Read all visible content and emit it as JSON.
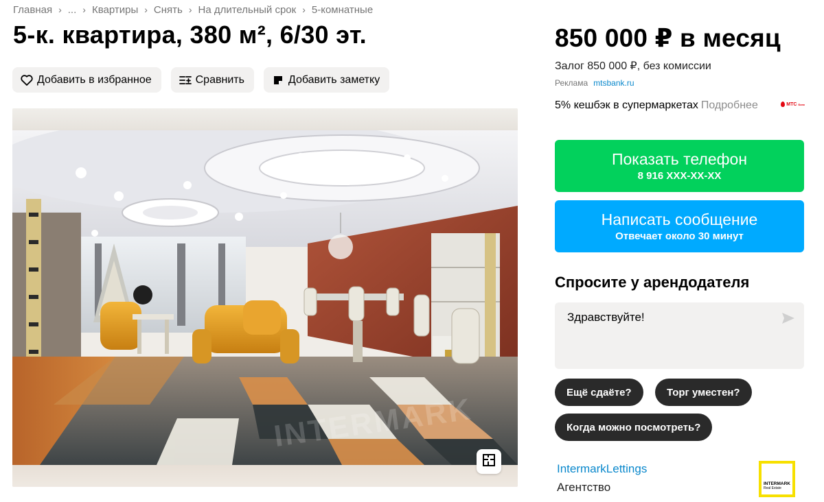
{
  "breadcrumbs": [
    {
      "label": "Главная"
    },
    {
      "label": "..."
    },
    {
      "label": "Квартиры"
    },
    {
      "label": "Снять"
    },
    {
      "label": "На длительный срок"
    },
    {
      "label": "5-комнатные"
    }
  ],
  "title": "5-к. квартира, 380 м², 6/30 эт.",
  "actions": {
    "favorite_label": "Добавить в избранное",
    "compare_label": "Сравнить",
    "note_label": "Добавить заметку"
  },
  "photo": {
    "watermark": "INTERMARK"
  },
  "pricing": {
    "price": "850 000 ₽ в месяц",
    "deposit": "Залог 850 000 ₽, без комиссии"
  },
  "ad": {
    "label": "Реклама",
    "link": "mtsbank.ru",
    "cashback_text": "5% кешбэк в супермаркетах",
    "cashback_more": "Подробнее",
    "logo_text": "МТС",
    "logo_subtext": "Банк"
  },
  "contact": {
    "phone_label": "Показать телефон",
    "phone_masked": "8 916 XXX-XX-XX",
    "message_label": "Написать сообщение",
    "message_sub": "Отвечает около 30 минут"
  },
  "ask": {
    "title": "Спросите у арендодателя",
    "message_value": "Здравствуйте!",
    "chips": [
      "Ещё сдаёте?",
      "Торг уместен?",
      "Когда можно посмотреть?"
    ]
  },
  "seller": {
    "name": "IntermarkLettings",
    "type": "Агентство",
    "logo_line1": "INTERMARK",
    "logo_line2": "Real Estate"
  },
  "colors": {
    "phone_button": "#02d15c",
    "message_button": "#00aaff",
    "link": "#0a88cc",
    "chip": "#2a2a2a",
    "brand_yellow": "#f7e000"
  }
}
